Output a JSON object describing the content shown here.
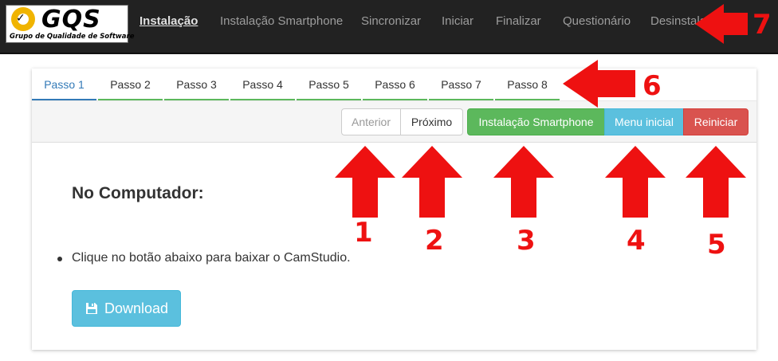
{
  "brand": {
    "logo_text": "GQS",
    "logo_subtitle": "Grupo de Qualidade de Software"
  },
  "nav": {
    "items": [
      {
        "label": "Instalação",
        "active": true
      },
      {
        "label": "Instalação Smartphone"
      },
      {
        "label": "Sincronizar"
      },
      {
        "label": "Iniciar"
      },
      {
        "label": "Finalizar"
      },
      {
        "label": "Questionário"
      },
      {
        "label": "Desinstalar"
      }
    ]
  },
  "steps": {
    "tabs": [
      {
        "label": "Passo 1",
        "active": true
      },
      {
        "label": "Passo 2"
      },
      {
        "label": "Passo 3"
      },
      {
        "label": "Passo 4"
      },
      {
        "label": "Passo 5"
      },
      {
        "label": "Passo 6"
      },
      {
        "label": "Passo 7"
      },
      {
        "label": "Passo 8"
      }
    ]
  },
  "toolbar": {
    "anterior": "Anterior",
    "proximo": "Próximo",
    "smartphone": "Instalação Smartphone",
    "menu_inicial": "Menu inicial",
    "reiniciar": "Reiniciar"
  },
  "content": {
    "title": "No Computador:",
    "instruction": "Clique no botão abaixo para baixar o CamStudio.",
    "download_label": "Download"
  },
  "annotations": {
    "numbers": [
      "1",
      "2",
      "3",
      "4",
      "5",
      "6",
      "7"
    ]
  },
  "colors": {
    "navbar": "#222222",
    "success": "#5cb85c",
    "info": "#5bc0de",
    "danger": "#d9534f",
    "primary": "#337ab7",
    "annotation_red": "#ee1111"
  }
}
